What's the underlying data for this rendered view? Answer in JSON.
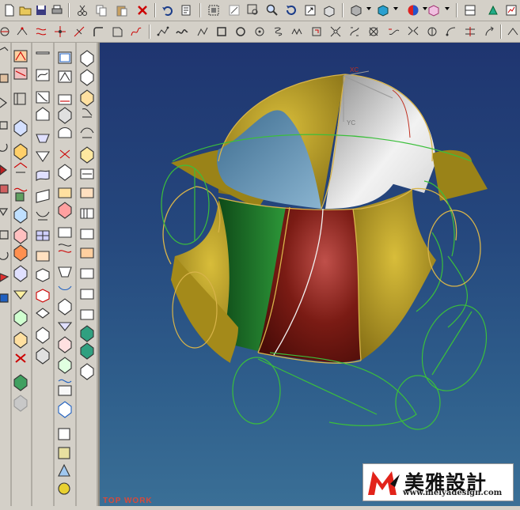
{
  "toolbar_standard": {
    "icons": [
      "new-file-icon",
      "open-folder-icon",
      "save-icon",
      "print-icon",
      "cut-icon",
      "copy-icon",
      "paste-icon",
      "delete-icon",
      "undo-icon",
      "properties-icon",
      "fit-all-icon",
      "zoom-window-icon",
      "zoom-icon",
      "zoom-magnify-icon",
      "rotate-icon",
      "pan-icon",
      "view-orientation-icon",
      "render-mode-icon",
      "display-cube-icon",
      "color-sphere-icon",
      "edit-object-icon",
      "layer-icon",
      "workbench-icon",
      "analysis-icon"
    ]
  },
  "toolbar_curves": {
    "icons": [
      "point-icon",
      "project-curve-icon",
      "offset-curve-icon",
      "intersection-curve-icon",
      "trim-curve-icon",
      "corner-icon",
      "fillet-curve-icon",
      "spline-icon",
      "point-set-icon",
      "curve-icon",
      "polyline-icon",
      "rectangle-icon",
      "circle-icon",
      "ellipse-icon",
      "helix-icon",
      "text-curve-icon",
      "spiral-icon",
      "extract-curve-icon",
      "iso-curve-icon",
      "section-curve-icon",
      "bridge-curve-icon",
      "join-curve-icon"
    ]
  },
  "viewport": {
    "view_name": "TOP WORK",
    "wcs_x_label": "XC",
    "wcs_y_label": "YC",
    "colors": {
      "yellow": "#b59a1c",
      "green": "#1f7a2a",
      "red": "#7a1b14",
      "white": "#e8e8e8",
      "blue": "#6a9ab8",
      "edge": "#d8b44a",
      "wire": "#3bbf3b"
    }
  },
  "logo": {
    "brand": "美雅設計",
    "url": "www.meiyadesign.com",
    "colors": {
      "red": "#e2231a"
    }
  }
}
